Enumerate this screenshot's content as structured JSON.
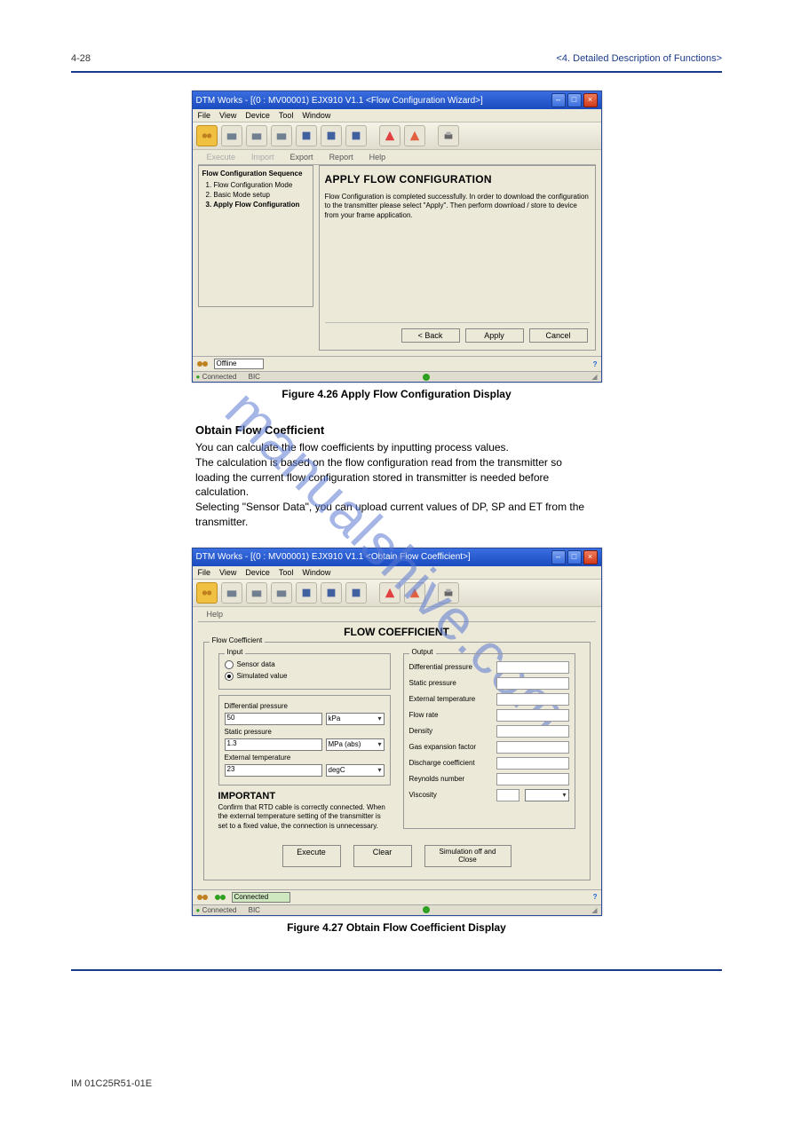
{
  "page": {
    "header_left": "",
    "header_right": "<4. Detailed Description of Functions>",
    "page_number_top": "4-28",
    "footer_left": "IM 01C25R51-01E",
    "footer_right": "",
    "watermark": "manualshive.com"
  },
  "fig1": {
    "caption": "Figure 4.26  Apply Flow Configuration Display",
    "title": "DTM Works - [(0 : MV00001) EJX910 V1.1 <Flow Configuration Wizard>]",
    "menu": [
      "File",
      "View",
      "Device",
      "Tool",
      "Window"
    ],
    "tabs": [
      "Execute",
      "Import",
      "Export",
      "Report",
      "Help"
    ],
    "side_header": "Flow Configuration Sequence",
    "steps": [
      "1. Flow Configuration Mode",
      "2. Basic Mode setup",
      "3. Apply Flow Configuration"
    ],
    "main_title": "APPLY FLOW CONFIGURATION",
    "main_text": "Flow Configuration is completed successfully. In order to download the configuration to the transmitter please select \"Apply\". Then perform download / store to device from your frame application.",
    "buttons": {
      "back": "< Back",
      "apply": "Apply",
      "cancel": "Cancel"
    },
    "status_label": "Offline",
    "status_bar_left": "Connected",
    "status_bar_mode": "BIC"
  },
  "section": {
    "heading": "Obtain Flow Coefficient",
    "text": "You can calculate the flow coefficients by inputting process values.\nThe calculation is based on the flow configuration read from the transmitter so loading the current flow configuration stored in transmitter is needed before calculation.\nSelecting \"Sensor Data\", you can upload current values of DP, SP and ET from the transmitter."
  },
  "fig2": {
    "caption": "Figure 4.27  Obtain Flow Coefficient Display",
    "title": "DTM Works - [(0 : MV00001) EJX910 V1.1 <Obtain Flow Coefficient>]",
    "menu": [
      "File",
      "View",
      "Device",
      "Tool",
      "Window"
    ],
    "help_tab": "Help",
    "main_title": "FLOW COEFFICIENT",
    "input_group": "Input",
    "flow_coef_group": "Flow Coefficient",
    "radios": {
      "sensor": "Sensor data",
      "sim": "Simulated value"
    },
    "selected_radio": "sim",
    "fields_group": "",
    "fields": [
      {
        "label": "Differential pressure",
        "value": "50",
        "unit": "kPa"
      },
      {
        "label": "Static pressure",
        "value": "1.3",
        "unit": "MPa (abs)"
      },
      {
        "label": "External temperature",
        "value": "23",
        "unit": "degC"
      }
    ],
    "important_hd": "IMPORTANT",
    "important_txt": "Confirm that RTD cable is correctly connected. When the external temperature setting of the transmitter is set to a fixed value, the connection is unnecessary.",
    "output_group": "Output",
    "outputs": [
      "Differential pressure",
      "Static pressure",
      "External temperature",
      "Flow rate",
      "Density",
      "Gas expansion factor",
      "Discharge coefficient",
      "Reynolds number",
      "Viscosity"
    ],
    "buttons": {
      "exec": "Execute",
      "clear": "Clear",
      "close": "Simulation off and\nClose"
    },
    "status_label": "Connected",
    "status_bar_left": "Connected",
    "status_bar_mode": "BIC"
  }
}
